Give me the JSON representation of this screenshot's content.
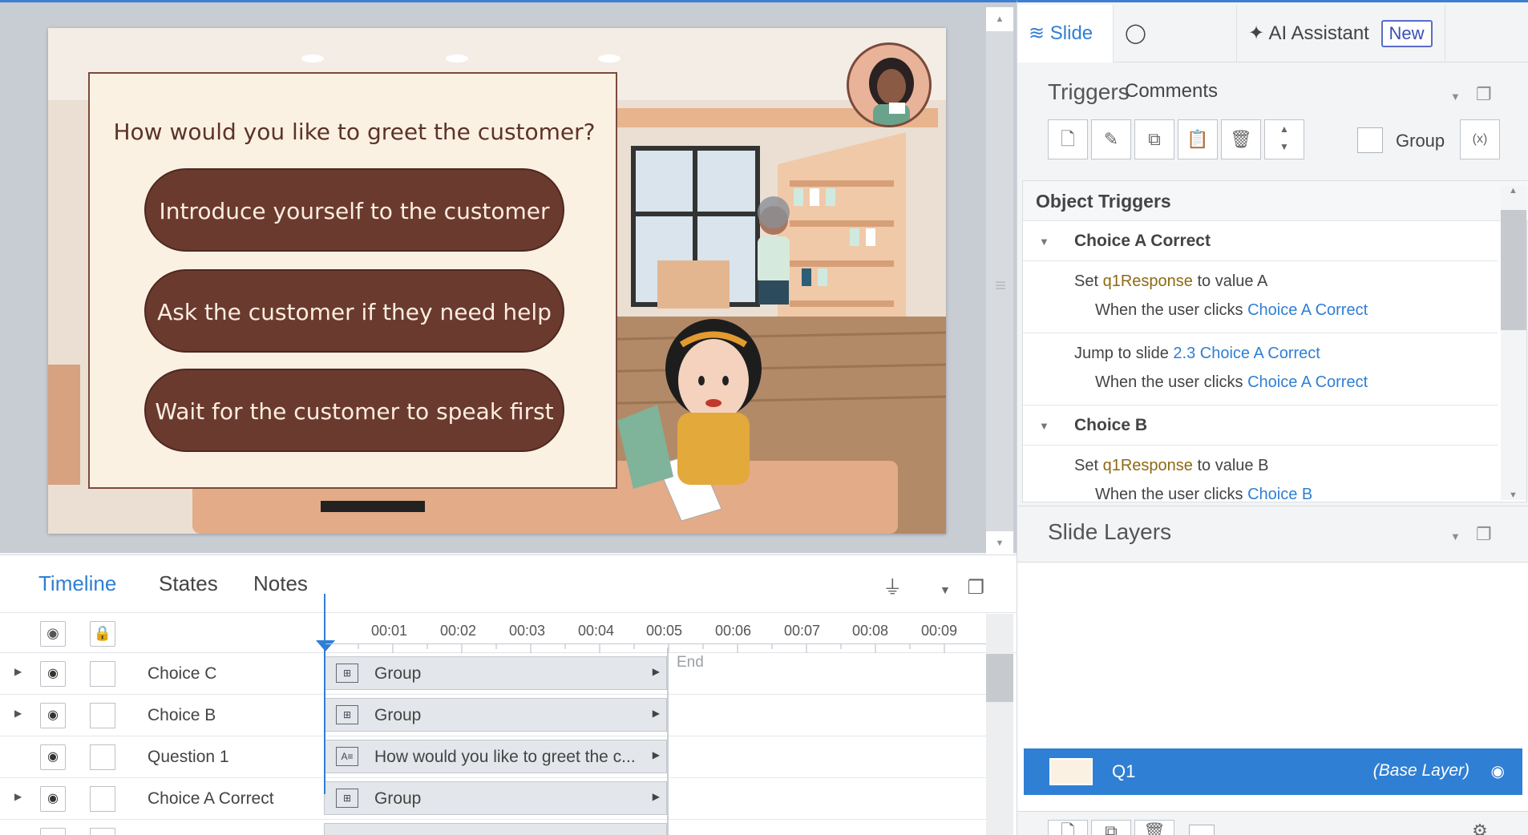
{
  "slide": {
    "question": "How would you like to greet the customer?",
    "choices": [
      "Introduce yourself to the customer",
      "Ask the customer if they need help",
      "Wait for the customer to speak first"
    ]
  },
  "timeline": {
    "tabs": [
      "Timeline",
      "States",
      "Notes"
    ],
    "times": [
      "00:01",
      "00:02",
      "00:03",
      "00:04",
      "00:05",
      "00:06",
      "00:07",
      "00:08",
      "00:09"
    ],
    "end_label": "End",
    "rows": [
      {
        "name": "Choice C",
        "bar": "Group"
      },
      {
        "name": "Choice B",
        "bar": "Group"
      },
      {
        "name": "Question 1",
        "bar": "How would you like to greet the c..."
      },
      {
        "name": "Choice A Correct",
        "bar": "Group"
      }
    ]
  },
  "right_panel": {
    "tabs": {
      "slide": "Slide",
      "comments": "Comments",
      "ai": "AI Assistant",
      "new_badge": "New"
    },
    "triggers_title": "Triggers",
    "group_label": "Group",
    "object_triggers": {
      "title": "Object Triggers",
      "groups": [
        {
          "name": "Choice A Correct",
          "items": [
            {
              "action": "Set",
              "var": "q1Response",
              "mid": "to value",
              "value": "A",
              "when": "When the user clicks",
              "target": "Choice A Correct"
            },
            {
              "action": "Jump to slide",
              "link": "2.3 Choice A Correct",
              "when": "When the user clicks",
              "target": "Choice A Correct"
            }
          ]
        },
        {
          "name": "Choice B",
          "items": [
            {
              "action": "Set",
              "var": "q1Response",
              "mid": "to value",
              "value": "B",
              "when": "When the user clicks",
              "target": "Choice B"
            }
          ]
        }
      ]
    },
    "slide_layers_title": "Slide Layers",
    "layer": {
      "name": "Q1",
      "base": "(Base Layer)"
    }
  }
}
